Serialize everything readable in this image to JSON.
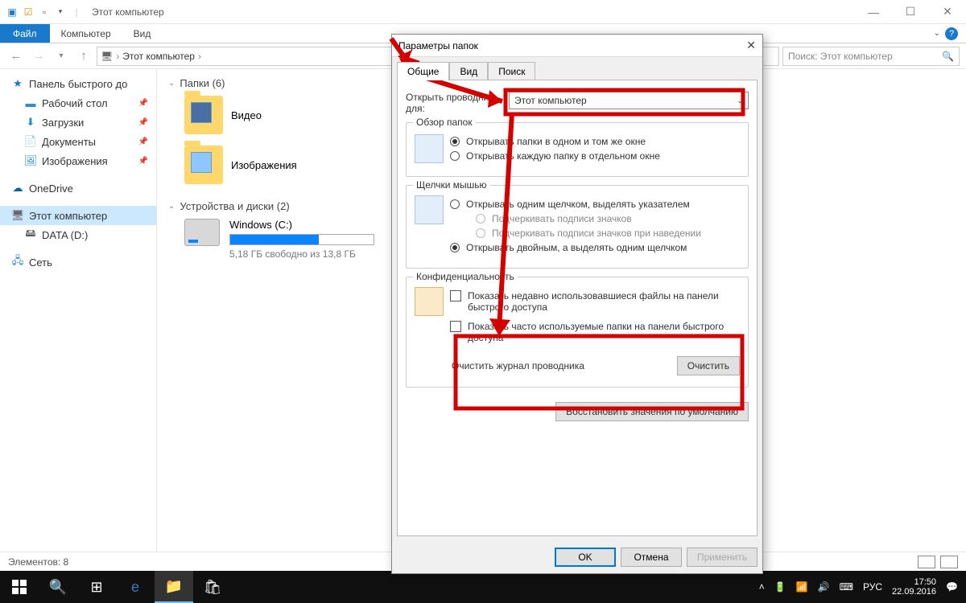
{
  "titlebar": {
    "title": "Этот компьютер"
  },
  "ribbon": {
    "file": "Файл",
    "computer": "Компьютер",
    "view": "Вид"
  },
  "address": {
    "crumb1": "Этот компьютер",
    "search_placeholder": "Поиск: Этот компьютер"
  },
  "sidebar": {
    "quick": "Панель быстрого до",
    "desktop": "Рабочий стол",
    "downloads": "Загрузки",
    "documents": "Документы",
    "pictures": "Изображения",
    "onedrive": "OneDrive",
    "thispc": "Этот компьютер",
    "data": "DATA (D:)",
    "network": "Сеть"
  },
  "content": {
    "folders_header": "Папки (6)",
    "video": "Видео",
    "pictures": "Изображения",
    "devices_header": "Устройства и диски (2)",
    "drive_name": "Windows (C:)",
    "drive_free": "5,18 ГБ свободно из 13,8 ГБ",
    "drive_fill_pct": 62
  },
  "statusbar": {
    "elements": "Элементов: 8"
  },
  "taskbar": {
    "time": "17:50",
    "date": "22.09.2016",
    "lang": "РУС"
  },
  "dialog": {
    "title": "Параметры папок",
    "tabs": {
      "general": "Общие",
      "view": "Вид",
      "search": "Поиск"
    },
    "open_explorer_label": "Открыть проводник для:",
    "open_explorer_value": "Этот компьютер",
    "browse_group": "Обзор папок",
    "browse_opt1": "Открывать папки в одном и том же окне",
    "browse_opt2": "Открывать каждую папку в отдельном окне",
    "click_group": "Щелчки мышью",
    "click_opt1": "Открывать одним щелчком, выделять указателем",
    "click_sub1": "Подчеркивать подписи значков",
    "click_sub2": "Подчеркивать подписи значков при наведении",
    "click_opt2": "Открывать двойным, а выделять одним щелчком",
    "privacy_group": "Конфиденциальность",
    "privacy_opt1": "Показать недавно использовавшиеся файлы на панели быстрого доступа",
    "privacy_opt2": "Показать часто используемые папки на панели быстрого доступа",
    "clear_label": "Очистить журнал проводника",
    "clear_btn": "Очистить",
    "restore_btn": "Восстановить значения по умолчанию",
    "ok": "OK",
    "cancel": "Отмена",
    "apply": "Применить"
  }
}
